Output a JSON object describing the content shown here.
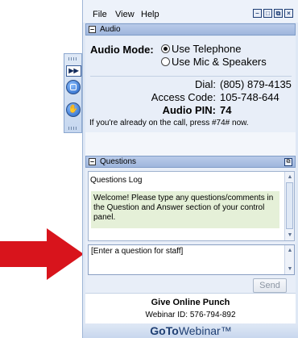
{
  "menubar": {
    "items": [
      "File",
      "View",
      "Help"
    ]
  },
  "window_buttons": [
    "minimize",
    "restore",
    "close-audio",
    "close"
  ],
  "audio": {
    "header": "Audio",
    "mode_label": "Audio Mode:",
    "options": [
      "Use Telephone",
      "Use Mic & Speakers"
    ],
    "selected_option": "Use Telephone",
    "dial_label": "Dial:",
    "dial_value": "(805) 879-4135",
    "access_label": "Access Code:",
    "access_value": "105-748-644",
    "pin_label": "Audio PIN:",
    "pin_value": "74",
    "call_note": "If you're already on the call, press #74# now."
  },
  "questions": {
    "header": "Questions",
    "log_title": "Questions Log",
    "welcome_message": "Welcome! Please type any questions/comments in the Question and Answer section of your control panel.",
    "input_placeholder": "[Enter a question for staff]",
    "send_label": "Send"
  },
  "footer": {
    "event_title": "Give Online Punch",
    "webinar_id": "Webinar ID: 576-794-892"
  },
  "brand": {
    "bold_part": "GoTo",
    "regular_part": "Webinar™"
  },
  "icons": [
    "grip-icon",
    "play-icon",
    "screen-icon",
    "hand-icon",
    "minus-icon",
    "popout-icon",
    "arrow-icon"
  ],
  "colors": {
    "arrow": "#d8141c",
    "panel_bg": "#dfe8f5",
    "header_bg": "#b9cbe9",
    "welcome_bg": "#e5f0d8"
  }
}
